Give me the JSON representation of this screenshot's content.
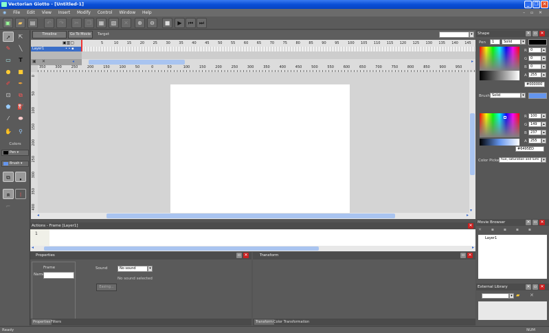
{
  "app": {
    "title": "Vectorian Giotto - [Untitled-1]"
  },
  "menu": {
    "items": [
      "File",
      "Edit",
      "View",
      "Insert",
      "Modify",
      "Control",
      "Window",
      "Help"
    ]
  },
  "timeline": {
    "timeline_tab": "Timeline",
    "go_to_movie": "Go To Movie",
    "target_label": "Target",
    "layer_name": "Layer1",
    "frame_numbers": [
      "5",
      "10",
      "15",
      "20",
      "25",
      "30",
      "35",
      "40",
      "45",
      "50",
      "55",
      "60",
      "65",
      "70",
      "75",
      "80",
      "85",
      "90",
      "95",
      "100",
      "105",
      "110",
      "115",
      "120",
      "125",
      "130",
      "135",
      "140",
      "145",
      "15"
    ]
  },
  "ruler": {
    "h_labels": [
      "350",
      "300",
      "250",
      "200",
      "150",
      "100",
      "50",
      "0",
      "50",
      "100",
      "150",
      "200",
      "250",
      "300",
      "350",
      "400",
      "450",
      "500",
      "550",
      "600",
      "650",
      "700",
      "750",
      "800",
      "850",
      "900",
      "950"
    ],
    "v_labels": [
      "0",
      "50",
      "100",
      "150",
      "200",
      "250",
      "300",
      "350",
      "400"
    ]
  },
  "toolbox": {
    "colors_label": "Colors",
    "pen_label": "Pen",
    "brush_label": "Brush",
    "pen_color": "#000000",
    "brush_color": "#6495ED"
  },
  "actions": {
    "title": "Actions - Frame [Layer1]",
    "line_number": "1"
  },
  "properties": {
    "title": "Properties",
    "group_label": "Frame",
    "name_label": "Name",
    "sound_label": "Sound",
    "sound_value": "No sound",
    "no_sound_text": "No sound selected",
    "easing_label": "Easing...",
    "tab_properties": "Properties",
    "tab_filters": "Filters"
  },
  "transform": {
    "title": "Transform",
    "tab_transform": "Transform",
    "tab_color": "Color Transformation"
  },
  "shape": {
    "title": "Shape",
    "pen_label": "Pen",
    "pen_width": "1",
    "pen_style": "Solid",
    "pen": {
      "r": "0",
      "g": "0",
      "b": "0",
      "a": "255",
      "hex": "#000000"
    },
    "brush_label": "Brush",
    "brush_style": "Solid",
    "brush": {
      "r": "100",
      "g": "149",
      "b": "237",
      "a": "255",
      "hex": "#6495ED"
    },
    "color_picker_label": "Color Picker",
    "color_picker_mode": "hue, saturation and lumi"
  },
  "movie_browser": {
    "title": "Movie Browser",
    "item": "Layer1"
  },
  "external_library": {
    "title": "External Library"
  },
  "status": {
    "left": "Ready",
    "right": "NUM"
  }
}
